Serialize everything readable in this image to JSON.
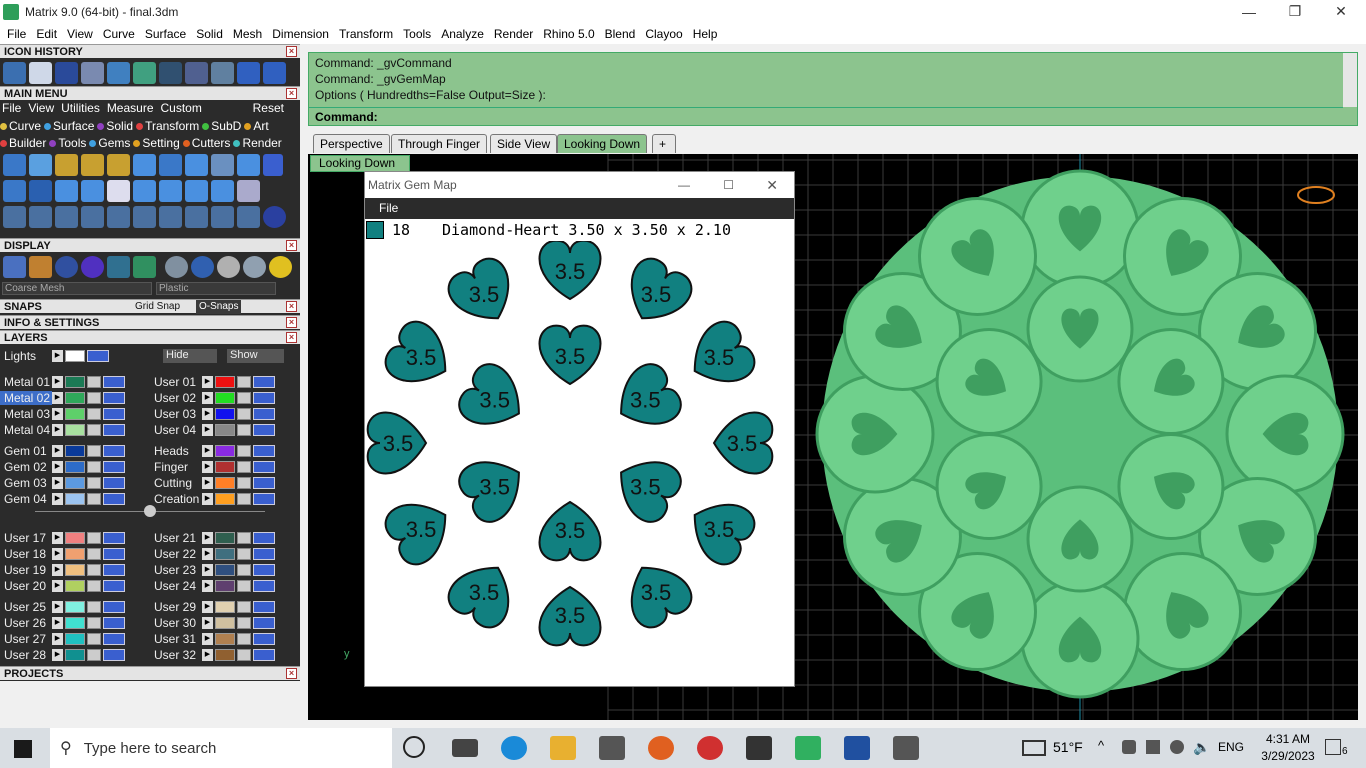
{
  "window": {
    "title": "Matrix 9.0 (64-bit) - final.3dm"
  },
  "menubar": [
    "File",
    "Edit",
    "View",
    "Curve",
    "Surface",
    "Solid",
    "Mesh",
    "Dimension",
    "Transform",
    "Tools",
    "Analyze",
    "Render",
    "Rhino 5.0",
    "Blend",
    "Clayoo",
    "Help"
  ],
  "left": {
    "icon_history": "ICON HISTORY",
    "main_menu": "MAIN MENU",
    "menu_items": [
      "File",
      "View",
      "Utilities",
      "Measure",
      "Custom"
    ],
    "reset": "Reset",
    "cats1": [
      {
        "t": "Curve",
        "c": "#e0c040"
      },
      {
        "t": "Surface",
        "c": "#40a0e0"
      },
      {
        "t": "Solid",
        "c": "#9040c0"
      },
      {
        "t": "Transform",
        "c": "#e04040"
      },
      {
        "t": "SubD",
        "c": "#40c040"
      },
      {
        "t": "Art",
        "c": "#e0a020"
      }
    ],
    "cats2": [
      {
        "t": "Builder",
        "c": "#e04040"
      },
      {
        "t": "Tools",
        "c": "#9040c0"
      },
      {
        "t": "Gems",
        "c": "#40a0e0"
      },
      {
        "t": "Setting",
        "c": "#e0a020"
      },
      {
        "t": "Cutters",
        "c": "#e06020"
      },
      {
        "t": "Render",
        "c": "#40c0c0"
      }
    ],
    "display": "DISPLAY",
    "mesh_select": "Coarse Mesh",
    "material_select": "Plastic",
    "snaps": "SNAPS",
    "grid_snap": "Grid Snap",
    "osnaps": "O-Snaps",
    "info": "INFO & SETTINGS",
    "layers": "LAYERS",
    "lights": "Lights",
    "hide": "Hide",
    "show": "Show",
    "projects": "PROJECTS"
  },
  "layers_left": [
    {
      "n": "Metal 01",
      "c": "#1b7a55"
    },
    {
      "n": "Metal 02",
      "c": "#2fa85a"
    },
    {
      "n": "Metal 03",
      "c": "#5ed06a"
    },
    {
      "n": "Metal 04",
      "c": "#a8e0a0"
    },
    {
      "n": "Gem 01",
      "c": "#0a3a9a"
    },
    {
      "n": "Gem 02",
      "c": "#2d6cc8"
    },
    {
      "n": "Gem 03",
      "c": "#5c9ae0"
    },
    {
      "n": "Gem 04",
      "c": "#9cc4f0"
    },
    {
      "n": "User 17",
      "c": "#f08080"
    },
    {
      "n": "User 18",
      "c": "#f0a070"
    },
    {
      "n": "User 19",
      "c": "#f0c080"
    },
    {
      "n": "User 20",
      "c": "#b0d060"
    },
    {
      "n": "User 25",
      "c": "#80f0e0"
    },
    {
      "n": "User 26",
      "c": "#40e0d0"
    },
    {
      "n": "User 27",
      "c": "#20c0c0"
    },
    {
      "n": "User 28",
      "c": "#109090"
    }
  ],
  "layers_right": [
    {
      "n": "User 01",
      "c": "#ee1111"
    },
    {
      "n": "User 02",
      "c": "#22dd22"
    },
    {
      "n": "User 03",
      "c": "#1111ee"
    },
    {
      "n": "User 04",
      "c": "#888888"
    },
    {
      "n": "Heads",
      "c": "#8a2be2"
    },
    {
      "n": "Finger",
      "c": "#b03030"
    },
    {
      "n": "Cutting",
      "c": "#ff7f27"
    },
    {
      "n": "Creation",
      "c": "#ff9f20"
    },
    {
      "n": "User 21",
      "c": "#2f5f4f"
    },
    {
      "n": "User 22",
      "c": "#3f6f7f"
    },
    {
      "n": "User 23",
      "c": "#2f4f7f"
    },
    {
      "n": "User 24",
      "c": "#5f3f6f"
    },
    {
      "n": "User 29",
      "c": "#e0d0b0"
    },
    {
      "n": "User 30",
      "c": "#d0c0a0"
    },
    {
      "n": "User 31",
      "c": "#b08050"
    },
    {
      "n": "User 32",
      "c": "#906030"
    }
  ],
  "command": {
    "lines": [
      "Command: _gvCommand",
      "Command: _gvGemMap",
      "Options ( Hundredths=False  Output=Size ):"
    ],
    "prompt": "Command:"
  },
  "tabs": [
    "Perspective",
    "Through Finger",
    "Side View",
    "Looking Down"
  ],
  "active_tab": "Looking Down",
  "viewport_label": "Looking Down",
  "axis_label": "y",
  "gemmap": {
    "title": "Matrix Gem Map",
    "menu": "File",
    "count": "18",
    "desc": "Diamond-Heart 3.50 x 3.50 x 2.10",
    "swatch": "#118080",
    "size_label": "3.5"
  },
  "taskbar": {
    "search_placeholder": "Type here to search",
    "temp": "51°F",
    "lang": "ENG",
    "time": "4:31 AM",
    "date": "3/29/2023",
    "notif": "6"
  }
}
